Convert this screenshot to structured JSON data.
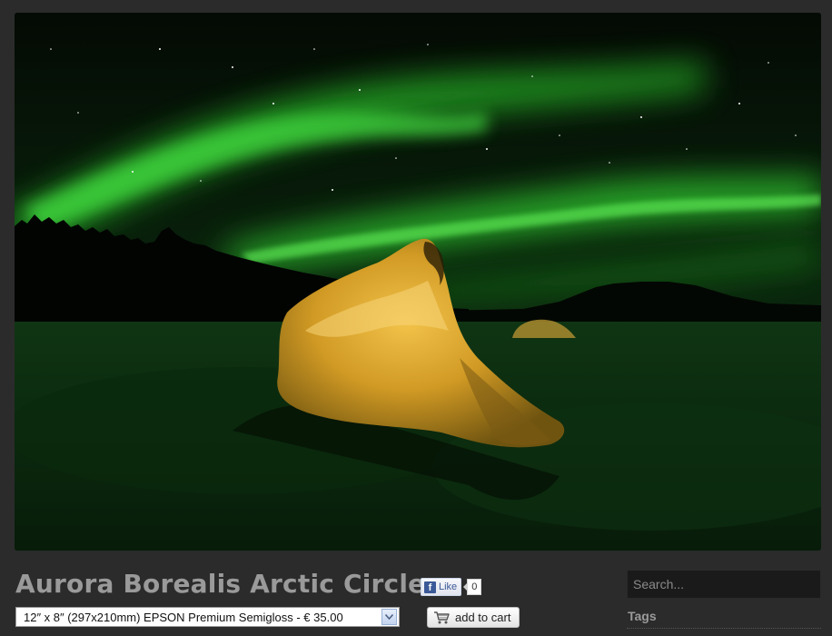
{
  "photo": {
    "subject": "aurora-borealis-photo"
  },
  "product": {
    "title": "Aurora Borealis Arctic Circle",
    "variant_selected": "12″ x 8″ (297x210mm) EPSON Premium Semigloss - € 35.00",
    "add_to_cart_label": "add to cart"
  },
  "social": {
    "like_label": "Like",
    "like_icon_letter": "f",
    "like_count": "0"
  },
  "sidebar": {
    "search_placeholder": "Search...",
    "tags_heading": "Tags"
  },
  "colors": {
    "page_bg": "#2b2b2b",
    "title_text": "#9a9a9a",
    "facebook_blue": "#3b5998",
    "aurora_green": "#2fd12f"
  }
}
